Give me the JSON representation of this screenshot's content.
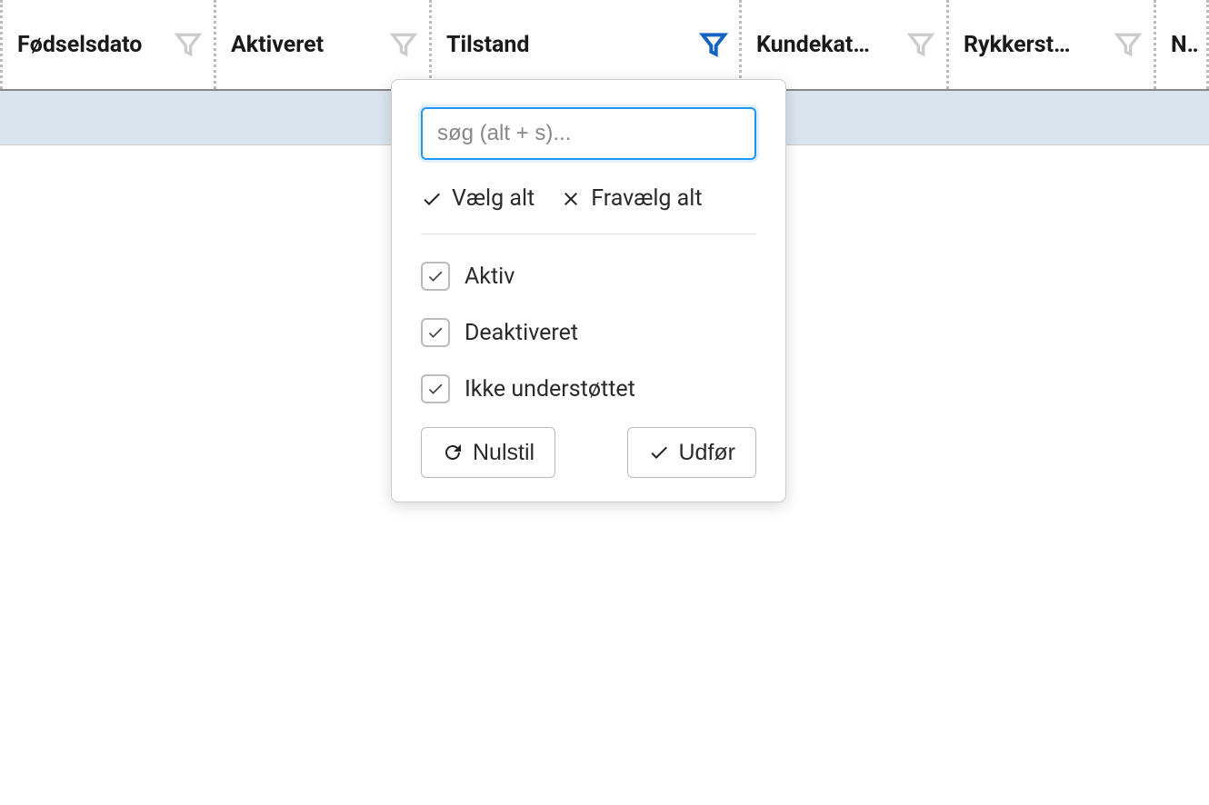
{
  "columns": [
    {
      "label": "Fødselsdato",
      "filter_active": false
    },
    {
      "label": "Aktiveret",
      "filter_active": false
    },
    {
      "label": "Tilstand",
      "filter_active": true
    },
    {
      "label": "Kundekat…",
      "filter_active": false
    },
    {
      "label": "Rykkerst…",
      "filter_active": false
    },
    {
      "label": "Næs",
      "filter_active": false
    }
  ],
  "filter_popup": {
    "search_placeholder": "søg (alt + s)...",
    "select_all_label": "Vælg alt",
    "deselect_all_label": "Fravælg alt",
    "options": [
      {
        "label": "Aktiv",
        "checked": true
      },
      {
        "label": "Deaktiveret",
        "checked": true
      },
      {
        "label": "Ikke understøttet",
        "checked": true
      }
    ],
    "reset_button": "Nulstil",
    "apply_button": "Udfør"
  }
}
